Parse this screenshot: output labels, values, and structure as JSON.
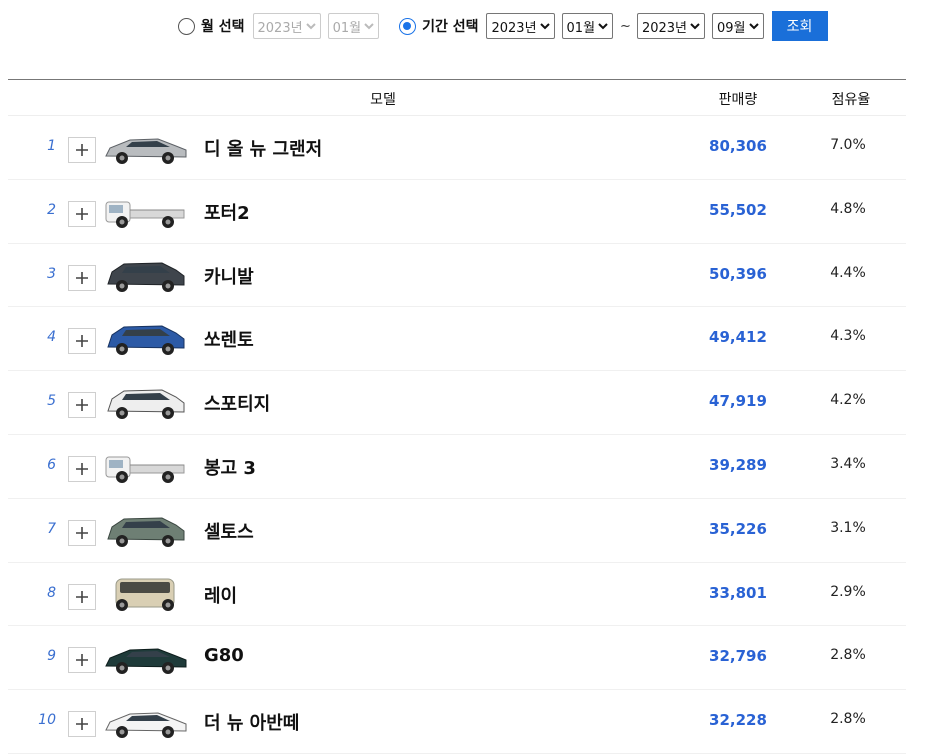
{
  "filter": {
    "month_label": "월 선택",
    "month_year": "2023년",
    "month_month": "01월",
    "period_label": "기간 선택",
    "from_year": "2023년",
    "from_month": "01월",
    "tilde": "~",
    "to_year": "2023년",
    "to_month": "09월",
    "query_button": "조회"
  },
  "table": {
    "headers": {
      "model": "모델",
      "sales": "판매량",
      "share": "점유율"
    },
    "rows": [
      {
        "rank": "1",
        "name": "디 올 뉴 그랜저",
        "sales": "80,306",
        "share": "7.0%",
        "car": "silver-sedan"
      },
      {
        "rank": "2",
        "name": "포터2",
        "sales": "55,502",
        "share": "4.8%",
        "car": "white-truck"
      },
      {
        "rank": "3",
        "name": "카니발",
        "sales": "50,396",
        "share": "4.4%",
        "car": "dark-gray-minivan"
      },
      {
        "rank": "4",
        "name": "쏘렌토",
        "sales": "49,412",
        "share": "4.3%",
        "car": "blue-suv"
      },
      {
        "rank": "5",
        "name": "스포티지",
        "sales": "47,919",
        "share": "4.2%",
        "car": "white-suv"
      },
      {
        "rank": "6",
        "name": "봉고 3",
        "sales": "39,289",
        "share": "3.4%",
        "car": "white-truck"
      },
      {
        "rank": "7",
        "name": "셀토스",
        "sales": "35,226",
        "share": "3.1%",
        "car": "green-gray-suv"
      },
      {
        "rank": "8",
        "name": "레이",
        "sales": "33,801",
        "share": "2.9%",
        "car": "beige-boxcar"
      },
      {
        "rank": "9",
        "name": "G80",
        "sales": "32,796",
        "share": "2.8%",
        "car": "dark-green-sedan"
      },
      {
        "rank": "10",
        "name": "더 뉴 아반떼",
        "sales": "32,228",
        "share": "2.8%",
        "car": "white-sedan"
      }
    ]
  },
  "colors": {
    "accent": "#1a6fd9",
    "sales_text": "#2962d4",
    "rank_text": "#3a6fd0"
  }
}
